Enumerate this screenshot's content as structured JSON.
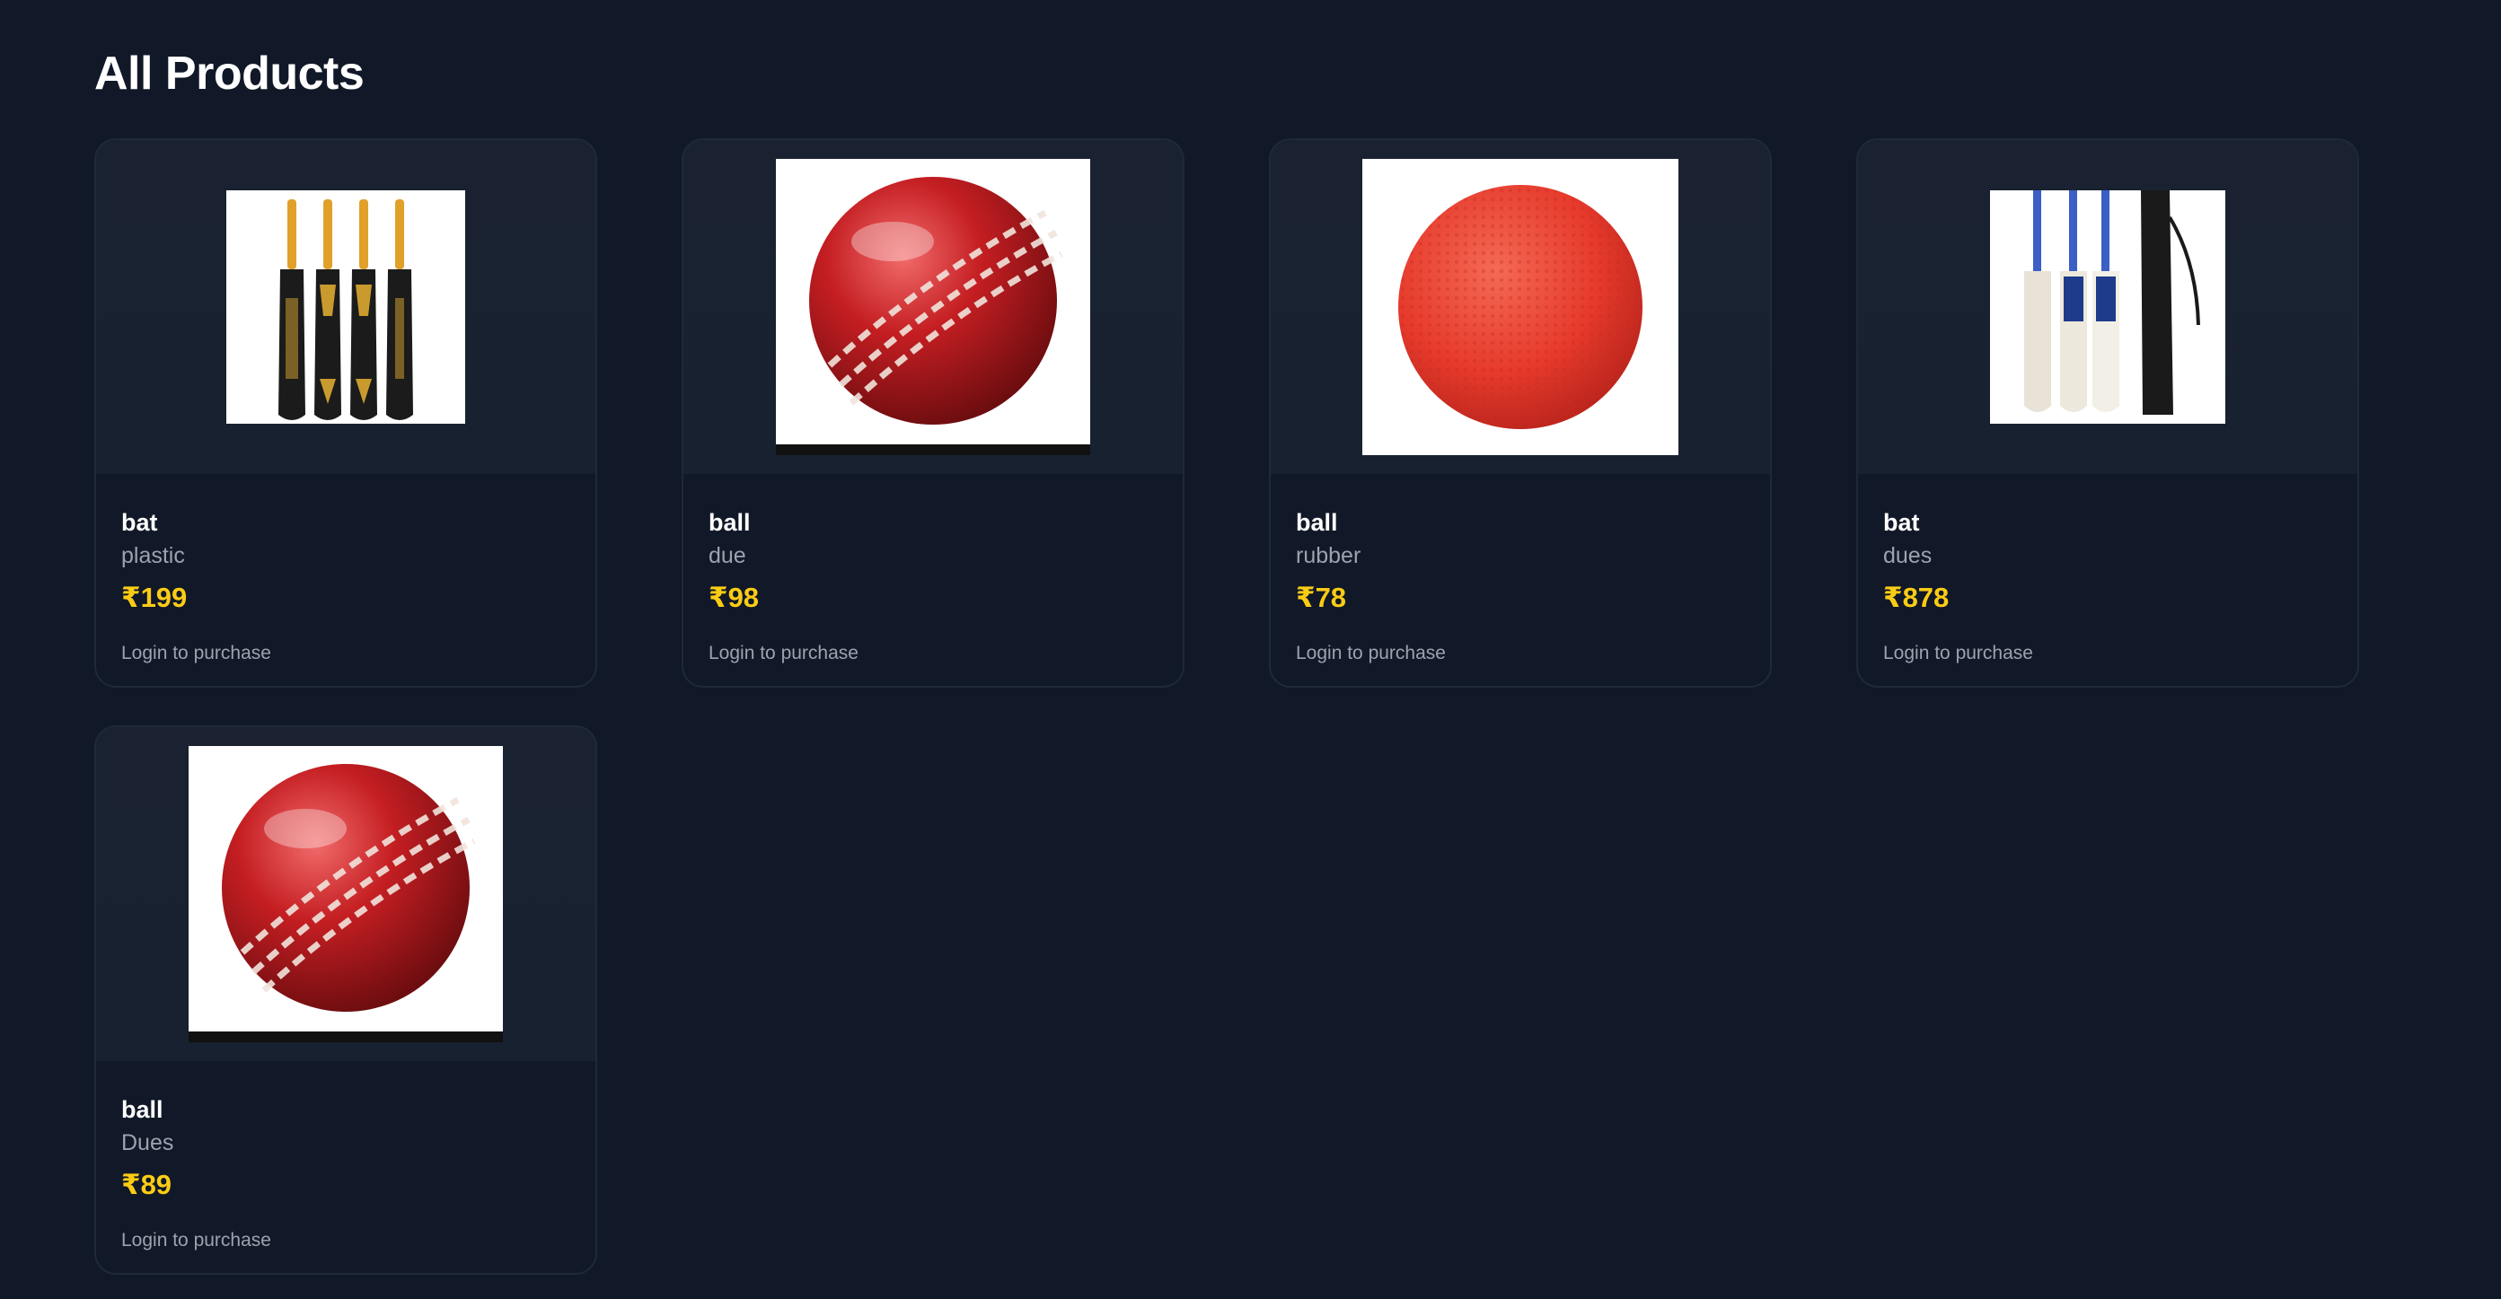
{
  "page": {
    "title": "All Products"
  },
  "products": [
    {
      "name": "bat",
      "description": "plastic",
      "price": "₹199",
      "action": "Login to purchase",
      "image": "cricket-bats-plastic"
    },
    {
      "name": "ball",
      "description": "due",
      "price": "₹98",
      "action": "Login to purchase",
      "image": "cricket-ball-red"
    },
    {
      "name": "ball",
      "description": "rubber",
      "price": "₹78",
      "action": "Login to purchase",
      "image": "rubber-ball-red"
    },
    {
      "name": "bat",
      "description": "dues",
      "price": "₹878",
      "action": "Login to purchase",
      "image": "cricket-bats-kit"
    },
    {
      "name": "ball",
      "description": "Dues",
      "price": "₹89",
      "action": "Login to purchase",
      "image": "cricket-ball-red"
    }
  ],
  "colors": {
    "background": "#111827",
    "price": "#facc15",
    "card_border": "#1f2937"
  }
}
